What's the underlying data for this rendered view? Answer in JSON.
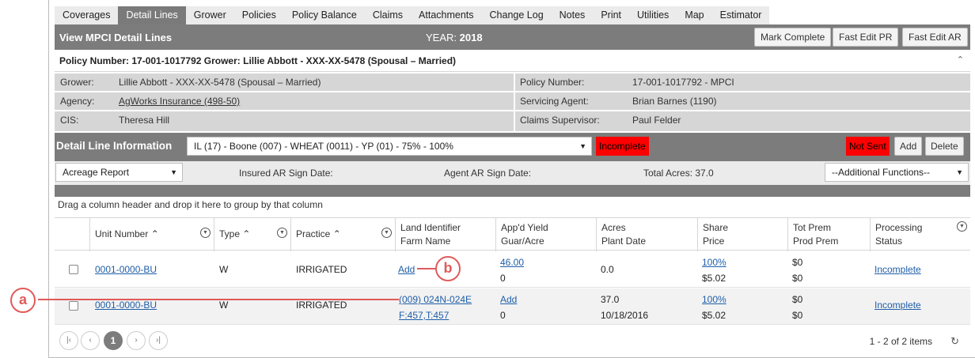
{
  "tabs": [
    "Coverages",
    "Detail Lines",
    "Grower",
    "Policies",
    "Policy Balance",
    "Claims",
    "Attachments",
    "Change Log",
    "Notes",
    "Print",
    "Utilities",
    "Map",
    "Estimator"
  ],
  "active_tab": "Detail Lines",
  "header": {
    "title": "View MPCI Detail Lines",
    "year_label": "YEAR:",
    "year_value": "2018",
    "mark_complete": "Mark Complete",
    "fast_edit_pr": "Fast Edit PR",
    "fast_edit_ar": "Fast Edit AR"
  },
  "policy_line": "Policy Number: 17-001-1017792 Grower: Lillie Abbott - XXX-XX-5478 (Spousal – Married)",
  "info": {
    "grower_label": "Grower:",
    "grower_value": "Lillie Abbott - XXX-XX-5478 (Spousal – Married)",
    "policy_label": "Policy Number:",
    "policy_value": "17-001-1017792 - MPCI",
    "agency_label": "Agency:",
    "agency_value": "AgWorks Insurance (498-50)",
    "agent_label": "Servicing Agent:",
    "agent_value": "Brian Barnes (1190)",
    "cis_label": "CIS:",
    "cis_value": "Theresa Hill",
    "supervisor_label": "Claims Supervisor:",
    "supervisor_value": "Paul Felder"
  },
  "detail": {
    "title": "Detail Line Information",
    "line_select": "IL (17) - Boone (007) - WHEAT (0011) - YP (01) - 75% - 100%",
    "status_badge": "Incomplete",
    "sent_badge": "Not Sent",
    "add": "Add",
    "delete": "Delete",
    "report_select": "Acreage Report",
    "insured_sign": "Insured AR Sign Date:",
    "agent_sign": "Agent AR Sign Date:",
    "total_acres": "Total Acres: 37.0",
    "additional": "--Additional Functions--"
  },
  "grid": {
    "group_hint": "Drag a column header and drop it here to group by that column",
    "headers": {
      "unit": "Unit Number",
      "type": "Type",
      "practice": "Practice",
      "land1": "Land Identifier",
      "land2": "Farm Name",
      "yield1": "App'd Yield",
      "yield2": "Guar/Acre",
      "acres1": "Acres",
      "acres2": "Plant Date",
      "share1": "Share",
      "share2": "Price",
      "prem1": "Tot Prem",
      "prem2": "Prod Prem",
      "proc1": "Processing",
      "proc2": "Status"
    },
    "rows": [
      {
        "unit": "0001-0000-BU",
        "type": "W",
        "practice": "IRRIGATED",
        "land1": "Add",
        "land2": "",
        "yield1": "46.00",
        "yield2": "0",
        "acres1": "0.0",
        "acres2": "",
        "share1": "100%",
        "share2": "$5.02",
        "prem1": "$0",
        "prem2": "$0",
        "status": "Incomplete"
      },
      {
        "unit": "0001-0000-BU",
        "type": "W",
        "practice": "IRRIGATED",
        "land1": "(009) 024N-024E",
        "land2": "F:457,T:457",
        "yield1": "Add",
        "yield2": "0",
        "acres1": "37.0",
        "acres2": "10/18/2016",
        "share1": "100%",
        "share2": "$5.02",
        "prem1": "$0",
        "prem2": "$0",
        "status": "Incomplete"
      }
    ],
    "page": "1",
    "pager_info": "1 - 2 of 2 items"
  },
  "callouts": {
    "a": "a",
    "b": "b"
  },
  "colors": {
    "header": "#7c7c7c",
    "link": "#1f5ea8",
    "alert": "#ff0000",
    "callout": "#e05a5a"
  }
}
